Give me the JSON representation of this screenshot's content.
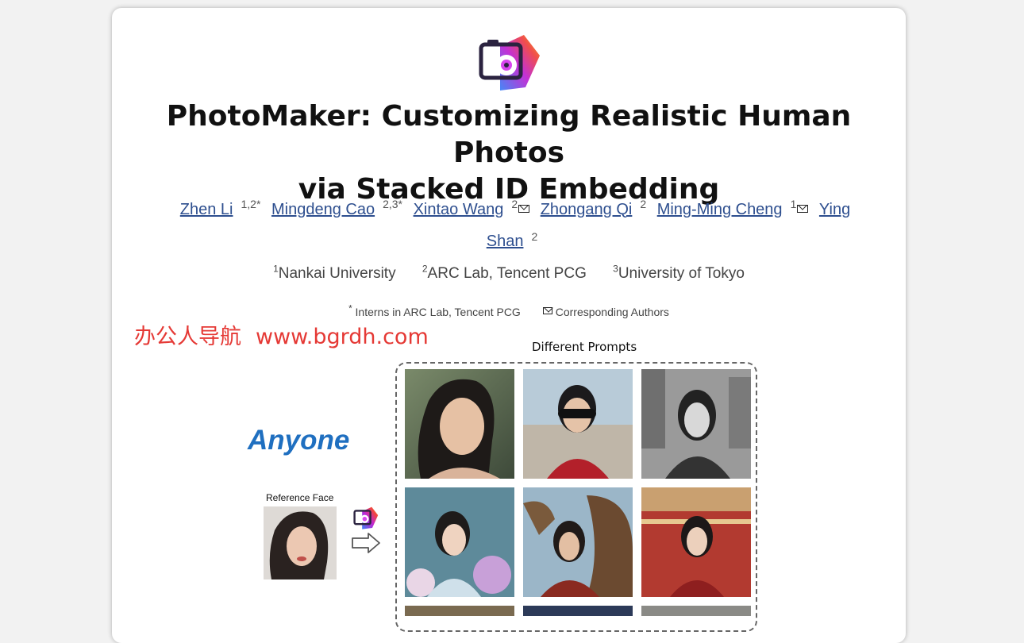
{
  "title": "PhotoMaker: Customizing Realistic Human Photos via Stacked ID Embedding",
  "title_lines": [
    "PhotoMaker: Customizing Realistic Human Photos",
    "via Stacked ID Embedding"
  ],
  "authors": [
    {
      "name": "Zhen Li",
      "sup": "1,2*",
      "mail": false
    },
    {
      "name": "Mingdeng Cao",
      "sup": "2,3*",
      "mail": false
    },
    {
      "name": "Xintao Wang",
      "sup": "2",
      "mail": true
    },
    {
      "name": "Zhongang Qi",
      "sup": "2",
      "mail": false
    },
    {
      "name": "Ming-Ming Cheng",
      "sup": "1",
      "mail": true
    },
    {
      "name": "Ying Shan",
      "sup": "2",
      "mail": false
    }
  ],
  "affiliations": [
    {
      "sup": "1",
      "name": "Nankai University"
    },
    {
      "sup": "2",
      "name": "ARC Lab, Tencent PCG"
    },
    {
      "sup": "3",
      "name": "University of Tokyo"
    }
  ],
  "notes": {
    "interns_mark": "*",
    "interns": "Interns in ARC Lab, Tencent PCG",
    "corresponding": "Corresponding Authors"
  },
  "watermark": {
    "site_name": "办公人导航",
    "url": "www.bgrdh.com"
  },
  "figure": {
    "prompts_label": "Different Prompts",
    "anyone_label": "Anyone",
    "reference_label": "Reference Face"
  },
  "colors": {
    "link": "#2e4f8f",
    "watermark": "#e53935",
    "anyone": "#1f6fc0"
  },
  "icons": [
    "photomaker-logo-icon",
    "mail-icon",
    "right-arrow-icon"
  ]
}
